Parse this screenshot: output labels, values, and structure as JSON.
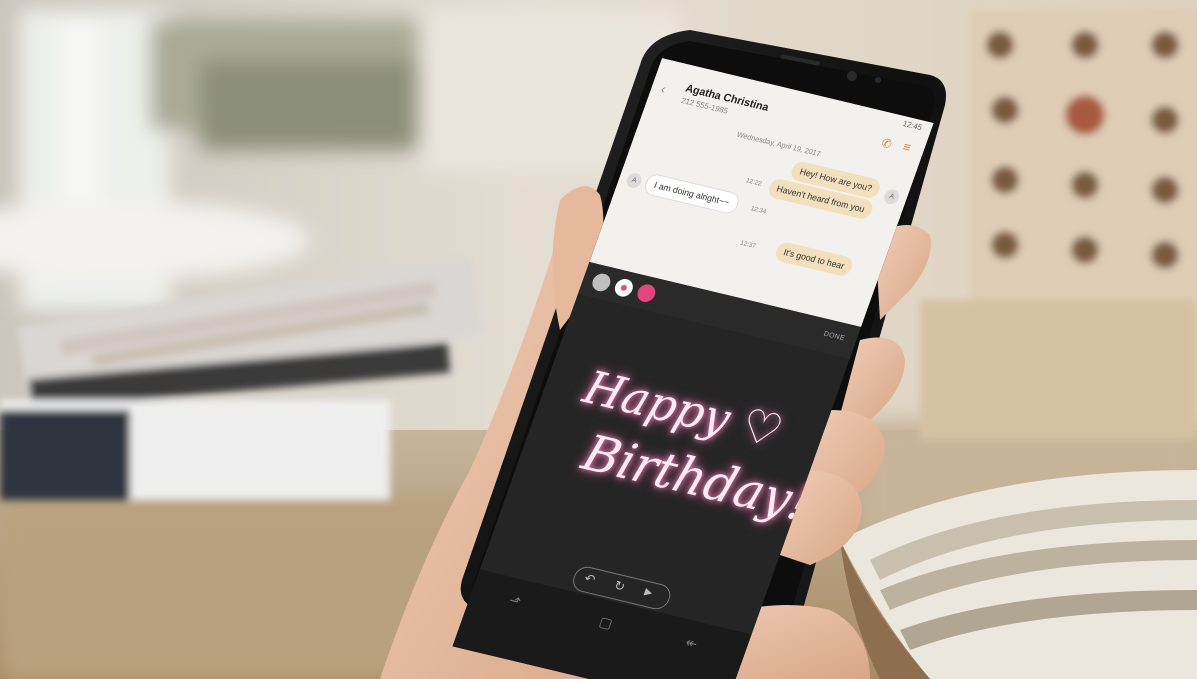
{
  "scene": {
    "description_colors": {
      "background_left": "#cfc8bd",
      "background_right": "#d9cdbb",
      "table": "#b89f7e",
      "skin": "#e7bfa4",
      "phone_body": "#121212"
    }
  },
  "phone": {
    "status_time": "12:45",
    "contact": {
      "name": "Agatha Christina",
      "phone": "212 555-1985"
    },
    "date_label": "Wednesday, April 19, 2017",
    "messages": [
      {
        "direction": "out",
        "text": "Hey! How are you?",
        "time": ""
      },
      {
        "direction": "out",
        "text": "Haven't heard from you",
        "time": "12:22"
      },
      {
        "direction": "in",
        "text": "I am doing alright~~",
        "time": "12:34"
      },
      {
        "direction": "out",
        "text": "It's good to hear",
        "time": "12:37"
      }
    ],
    "avatar_initial": "A",
    "toolbar": {
      "done_label": "DONE"
    },
    "handwriting": {
      "line1": "Happy",
      "heart": "♡",
      "line2": "Birthday!"
    },
    "controls": {
      "undo": "↶",
      "redo": "↻",
      "play": "▶"
    },
    "nav": {
      "recent": "⬏",
      "home": "▢",
      "back": "↞"
    },
    "accent": "#e0457b"
  }
}
